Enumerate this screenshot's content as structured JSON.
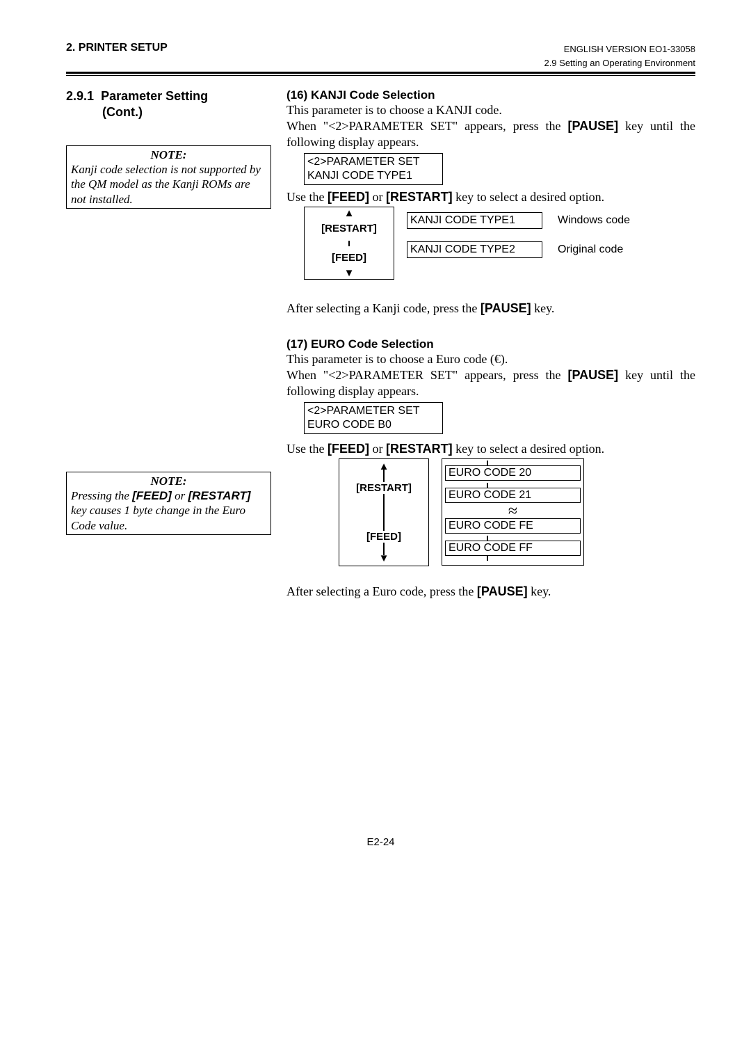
{
  "header": {
    "left": "2. PRINTER SETUP",
    "right_line1": "ENGLISH VERSION EO1-33058",
    "right_line2": "2.9 Setting an Operating Environment"
  },
  "left_col": {
    "section_number": "2.9.1",
    "section_title_a": "Parameter Setting",
    "section_title_b": "(Cont.)",
    "note1_label": "NOTE:",
    "note1_text": "Kanji code selection is not supported by the QM model as the Kanji ROMs are not installed.",
    "note2_label": "NOTE:",
    "note2_text_a": "Pressing the ",
    "note2_feed": "[FEED]",
    "note2_text_b": " or ",
    "note2_restart": "[RESTART]",
    "note2_text_c": " key causes 1 byte change in the Euro Code value."
  },
  "s16": {
    "heading": "(16)  KANJI Code Selection",
    "p1": "This parameter is to choose a KANJI code.",
    "p2a": "When \"<2>PARAMETER SET\" appears, press the ",
    "pause1": "[PAUSE]",
    "p2b": " key until the following display appears.",
    "disp_l1": "<2>PARAMETER SET",
    "disp_l2": "KANJI CODE TYPE1",
    "p3a": "Use the ",
    "feed1": "[FEED]",
    "p3b": " or ",
    "restart1": "[RESTART]",
    "p3c": " key to select a desired option.",
    "flow_restart": "[RESTART]",
    "flow_feed": "[FEED]",
    "opt1": "KANJI CODE TYPE1",
    "opt1_desc": "Windows code",
    "opt2": "KANJI CODE TYPE2",
    "opt2_desc": "Original code",
    "p4a": "After selecting a Kanji code, press the ",
    "pause2": "[PAUSE]",
    "p4b": " key."
  },
  "s17": {
    "heading": "(17)  EURO Code Selection",
    "p1": "This parameter is to choose a Euro code (€).",
    "p2a": "When \"<2>PARAMETER SET\" appears, press the ",
    "pause1": "[PAUSE]",
    "p2b": " key until the following display appears.",
    "disp_l1": "<2>PARAMETER SET",
    "disp_l2": "EURO CODE   B0",
    "p3a": "Use the ",
    "feed1": "[FEED]",
    "p3b": " or ",
    "restart1": "[RESTART]",
    "p3c": " key to select a desired option.",
    "flow_restart": "[RESTART]",
    "flow_feed": "[FEED]",
    "opts": [
      "EURO CODE    20",
      "EURO CODE    21",
      "EURO CODE    FE",
      "EURO CODE    FF"
    ],
    "p4a": "After selecting a Euro code, press the ",
    "pause2": "[PAUSE]",
    "p4b": " key."
  },
  "page_num": "E2-24"
}
